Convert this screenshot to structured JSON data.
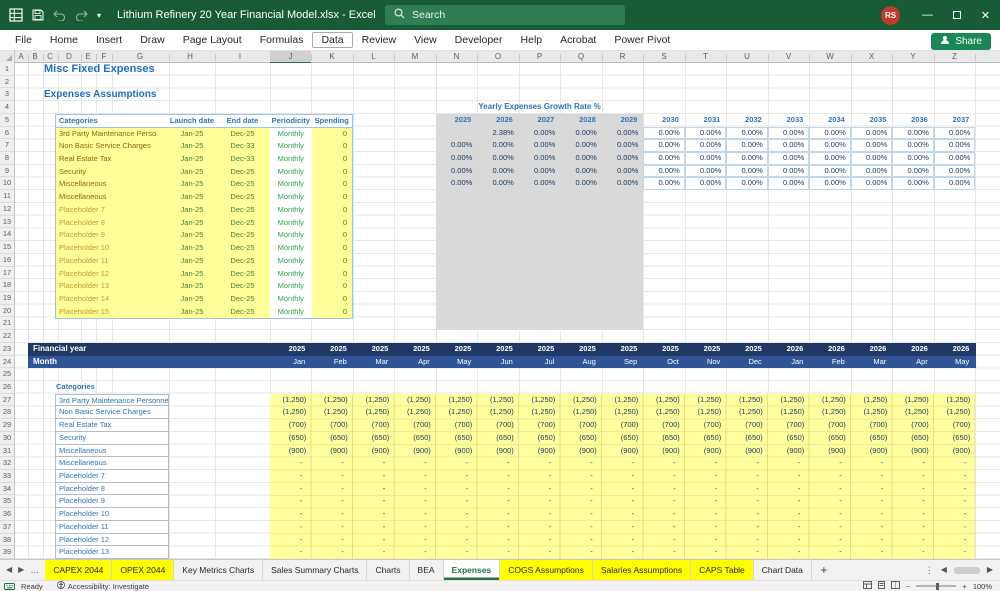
{
  "title_bar": {
    "app_title": "Lithium Refinery 20 Year Financial Model.xlsx - Excel",
    "search_placeholder": "Search",
    "user_initials": "RS"
  },
  "ribbon": {
    "tabs": [
      "File",
      "Home",
      "Insert",
      "Draw",
      "Page Layout",
      "Formulas",
      "Data",
      "Review",
      "View",
      "Developer",
      "Help",
      "Acrobat",
      "Power Pivot"
    ],
    "active_tab": "Data",
    "share_label": "Share"
  },
  "sheet": {
    "column_letters": [
      "A",
      "B",
      "C",
      "D",
      "E",
      "F",
      "G",
      "H",
      "I",
      "J",
      "K",
      "L",
      "M",
      "N",
      "O",
      "P",
      "Q",
      "R",
      "S",
      "T",
      "U",
      "V",
      "W",
      "X",
      "Y",
      "Z"
    ],
    "highlighted_column": "J",
    "row_count": 39,
    "title": "Misc Fixed Expenses",
    "section_title": "Expenses Assumptions"
  },
  "assumptions_table": {
    "headers": [
      "Categories",
      "Launch date",
      "End date",
      "Periodicity",
      "Spending"
    ],
    "rows": [
      {
        "category": "3rd Party Maintenance Perso",
        "launch": "Jan-25",
        "end": "Dec-25",
        "periodicity": "Monthly",
        "spending": "0"
      },
      {
        "category": "Non Basic Service Charges",
        "launch": "Jan-25",
        "end": "Dec-33",
        "periodicity": "Monthly",
        "spending": "0"
      },
      {
        "category": "Real Estate Tax",
        "launch": "Jan-25",
        "end": "Dec-33",
        "periodicity": "Monthly",
        "spending": "0"
      },
      {
        "category": "Security",
        "launch": "Jan-25",
        "end": "Dec-25",
        "periodicity": "Monthly",
        "spending": "0"
      },
      {
        "category": "Miscellaneous",
        "launch": "Jan-25",
        "end": "Dec-25",
        "periodicity": "Monthly",
        "spending": "0"
      },
      {
        "category": "Miscellaneous",
        "launch": "Jan-25",
        "end": "Dec-25",
        "periodicity": "Monthly",
        "spending": "0"
      },
      {
        "category": "Placeholder 7",
        "launch": "Jan-25",
        "end": "Dec-25",
        "periodicity": "Monthly",
        "spending": "0"
      },
      {
        "category": "Placeholder 8",
        "launch": "Jan-25",
        "end": "Dec-25",
        "periodicity": "Monthly",
        "spending": "0"
      },
      {
        "category": "Placeholder 9",
        "launch": "Jan-25",
        "end": "Dec-25",
        "periodicity": "Monthly",
        "spending": "0"
      },
      {
        "category": "Placeholder 10",
        "launch": "Jan-25",
        "end": "Dec-25",
        "periodicity": "Monthly",
        "spending": "0"
      },
      {
        "category": "Placeholder 11",
        "launch": "Jan-25",
        "end": "Dec-25",
        "periodicity": "Monthly",
        "spending": "0"
      },
      {
        "category": "Placeholder 12",
        "launch": "Jan-25",
        "end": "Dec-25",
        "periodicity": "Monthly",
        "spending": "0"
      },
      {
        "category": "Placeholder 13",
        "launch": "Jan-25",
        "end": "Dec-25",
        "periodicity": "Monthly",
        "spending": "0"
      },
      {
        "category": "Placeholder 14",
        "launch": "Jan-25",
        "end": "Dec-25",
        "periodicity": "Monthly",
        "spending": "0"
      },
      {
        "category": "Placeholder 15",
        "launch": "Jan-25",
        "end": "Dec-25",
        "periodicity": "Monthly",
        "spending": "0"
      }
    ]
  },
  "growth_table": {
    "title": "Yearly Expenses Growth Rate %",
    "years": [
      "2025",
      "2026",
      "2027",
      "2028",
      "2029",
      "2030",
      "2031",
      "2032",
      "2033",
      "2034",
      "2035",
      "2036",
      "2037"
    ],
    "rows": [
      [
        "",
        "2.38%",
        "0.00%",
        "0.00%",
        "0.00%",
        "0.00%",
        "0.00%",
        "0.00%",
        "0.00%",
        "0.00%",
        "0.00%",
        "0.00%",
        "0.00%"
      ],
      [
        "0.00%",
        "0.00%",
        "0.00%",
        "0.00%",
        "0.00%",
        "0.00%",
        "0.00%",
        "0.00%",
        "0.00%",
        "0.00%",
        "0.00%",
        "0.00%",
        "0.00%"
      ],
      [
        "0.00%",
        "0.00%",
        "0.00%",
        "0.00%",
        "0.00%",
        "0.00%",
        "0.00%",
        "0.00%",
        "0.00%",
        "0.00%",
        "0.00%",
        "0.00%",
        "0.00%"
      ],
      [
        "0.00%",
        "0.00%",
        "0.00%",
        "0.00%",
        "0.00%",
        "0.00%",
        "0.00%",
        "0.00%",
        "0.00%",
        "0.00%",
        "0.00%",
        "0.00%",
        "0.00%"
      ],
      [
        "0.00%",
        "0.00%",
        "0.00%",
        "0.00%",
        "0.00%",
        "0.00%",
        "0.00%",
        "0.00%",
        "0.00%",
        "0.00%",
        "0.00%",
        "0.00%",
        "0.00%"
      ]
    ]
  },
  "monthly_table": {
    "financial_year_label": "Financial year",
    "month_label": "Month",
    "years": [
      "2025",
      "2025",
      "2025",
      "2025",
      "2025",
      "2025",
      "2025",
      "2025",
      "2025",
      "2025",
      "2025",
      "2025",
      "2026",
      "2026",
      "2026",
      "2026",
      "2026"
    ],
    "months": [
      "Jan",
      "Feb",
      "Mar",
      "Apr",
      "May",
      "Jun",
      "Jul",
      "Aug",
      "Sep",
      "Oct",
      "Nov",
      "Dec",
      "Jan",
      "Feb",
      "Mar",
      "Apr",
      "May"
    ],
    "categories_label": "Categories",
    "rows": [
      {
        "category": "3rd Party Maintenance Personnel",
        "value": "(1,250)"
      },
      {
        "category": "Non Basic Service Charges",
        "value": "(1,250)"
      },
      {
        "category": "Real Estate Tax",
        "value": "(700)"
      },
      {
        "category": "Security",
        "value": "(650)"
      },
      {
        "category": "Miscellaneous",
        "value": "(900)"
      },
      {
        "category": "Miscellaneous",
        "value": "-"
      },
      {
        "category": "Placeholder 7",
        "value": "-"
      },
      {
        "category": "Placeholder 8",
        "value": "-"
      },
      {
        "category": "Placeholder 9",
        "value": "-"
      },
      {
        "category": "Placeholder 10",
        "value": "-"
      },
      {
        "category": "Placeholder 11",
        "value": "-"
      },
      {
        "category": "Placeholder 12",
        "value": "-"
      },
      {
        "category": "Placeholder 13",
        "value": "-"
      }
    ]
  },
  "sheet_tabs": [
    {
      "label": "CAPEX 2044",
      "style": "yellow"
    },
    {
      "label": "OPEX 2044",
      "style": "yellow"
    },
    {
      "label": "Key Metrics Charts",
      "style": "plain"
    },
    {
      "label": "Sales Summary Charts",
      "style": "plain"
    },
    {
      "label": "Charts",
      "style": "plain"
    },
    {
      "label": "BEA",
      "style": "plain"
    },
    {
      "label": "Expenses",
      "style": "active"
    },
    {
      "label": "COGS Assumptions",
      "style": "yellow"
    },
    {
      "label": "Salaries Assumptions",
      "style": "yellow"
    },
    {
      "label": "CAPS Table",
      "style": "yellow"
    },
    {
      "label": "Chart Data",
      "style": "plain"
    }
  ],
  "status_bar": {
    "mode": "Ready",
    "accessibility": "Accessibility: Investigate",
    "zoom": "100%"
  },
  "colors": {
    "titlebar_green": "#185C37",
    "accent_green": "#217346",
    "tab_yellow": "#FFFF00",
    "cell_yellow": "#FFFF99",
    "banner_navy": "#1F3864",
    "banner_blue": "#2F5597",
    "heading_blue": "#2E75B6",
    "value_navy": "#17375E",
    "growth_gray": "#D9D9D9"
  }
}
